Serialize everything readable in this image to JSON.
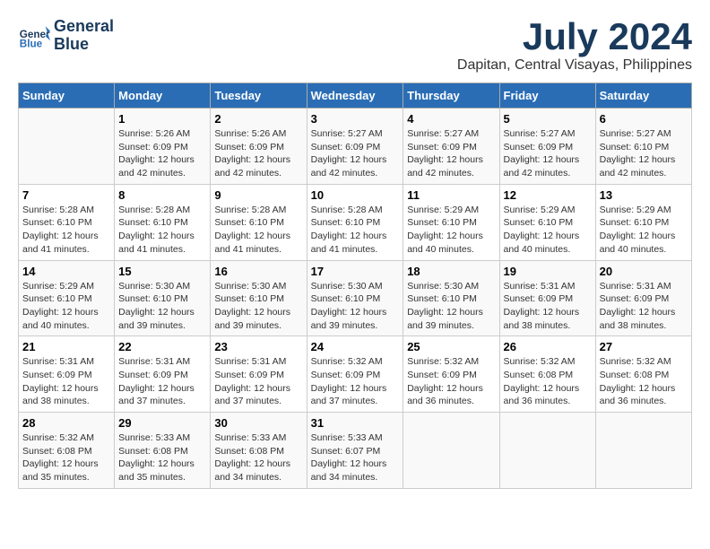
{
  "logo": {
    "line1": "General",
    "line2": "Blue"
  },
  "title": "July 2024",
  "subtitle": "Dapitan, Central Visayas, Philippines",
  "days_header": [
    "Sunday",
    "Monday",
    "Tuesday",
    "Wednesday",
    "Thursday",
    "Friday",
    "Saturday"
  ],
  "weeks": [
    [
      {
        "day": "",
        "info": ""
      },
      {
        "day": "1",
        "info": "Sunrise: 5:26 AM\nSunset: 6:09 PM\nDaylight: 12 hours\nand 42 minutes."
      },
      {
        "day": "2",
        "info": "Sunrise: 5:26 AM\nSunset: 6:09 PM\nDaylight: 12 hours\nand 42 minutes."
      },
      {
        "day": "3",
        "info": "Sunrise: 5:27 AM\nSunset: 6:09 PM\nDaylight: 12 hours\nand 42 minutes."
      },
      {
        "day": "4",
        "info": "Sunrise: 5:27 AM\nSunset: 6:09 PM\nDaylight: 12 hours\nand 42 minutes."
      },
      {
        "day": "5",
        "info": "Sunrise: 5:27 AM\nSunset: 6:09 PM\nDaylight: 12 hours\nand 42 minutes."
      },
      {
        "day": "6",
        "info": "Sunrise: 5:27 AM\nSunset: 6:10 PM\nDaylight: 12 hours\nand 42 minutes."
      }
    ],
    [
      {
        "day": "7",
        "info": "Sunrise: 5:28 AM\nSunset: 6:10 PM\nDaylight: 12 hours\nand 41 minutes."
      },
      {
        "day": "8",
        "info": "Sunrise: 5:28 AM\nSunset: 6:10 PM\nDaylight: 12 hours\nand 41 minutes."
      },
      {
        "day": "9",
        "info": "Sunrise: 5:28 AM\nSunset: 6:10 PM\nDaylight: 12 hours\nand 41 minutes."
      },
      {
        "day": "10",
        "info": "Sunrise: 5:28 AM\nSunset: 6:10 PM\nDaylight: 12 hours\nand 41 minutes."
      },
      {
        "day": "11",
        "info": "Sunrise: 5:29 AM\nSunset: 6:10 PM\nDaylight: 12 hours\nand 40 minutes."
      },
      {
        "day": "12",
        "info": "Sunrise: 5:29 AM\nSunset: 6:10 PM\nDaylight: 12 hours\nand 40 minutes."
      },
      {
        "day": "13",
        "info": "Sunrise: 5:29 AM\nSunset: 6:10 PM\nDaylight: 12 hours\nand 40 minutes."
      }
    ],
    [
      {
        "day": "14",
        "info": "Sunrise: 5:29 AM\nSunset: 6:10 PM\nDaylight: 12 hours\nand 40 minutes."
      },
      {
        "day": "15",
        "info": "Sunrise: 5:30 AM\nSunset: 6:10 PM\nDaylight: 12 hours\nand 39 minutes."
      },
      {
        "day": "16",
        "info": "Sunrise: 5:30 AM\nSunset: 6:10 PM\nDaylight: 12 hours\nand 39 minutes."
      },
      {
        "day": "17",
        "info": "Sunrise: 5:30 AM\nSunset: 6:10 PM\nDaylight: 12 hours\nand 39 minutes."
      },
      {
        "day": "18",
        "info": "Sunrise: 5:30 AM\nSunset: 6:10 PM\nDaylight: 12 hours\nand 39 minutes."
      },
      {
        "day": "19",
        "info": "Sunrise: 5:31 AM\nSunset: 6:09 PM\nDaylight: 12 hours\nand 38 minutes."
      },
      {
        "day": "20",
        "info": "Sunrise: 5:31 AM\nSunset: 6:09 PM\nDaylight: 12 hours\nand 38 minutes."
      }
    ],
    [
      {
        "day": "21",
        "info": "Sunrise: 5:31 AM\nSunset: 6:09 PM\nDaylight: 12 hours\nand 38 minutes."
      },
      {
        "day": "22",
        "info": "Sunrise: 5:31 AM\nSunset: 6:09 PM\nDaylight: 12 hours\nand 37 minutes."
      },
      {
        "day": "23",
        "info": "Sunrise: 5:31 AM\nSunset: 6:09 PM\nDaylight: 12 hours\nand 37 minutes."
      },
      {
        "day": "24",
        "info": "Sunrise: 5:32 AM\nSunset: 6:09 PM\nDaylight: 12 hours\nand 37 minutes."
      },
      {
        "day": "25",
        "info": "Sunrise: 5:32 AM\nSunset: 6:09 PM\nDaylight: 12 hours\nand 36 minutes."
      },
      {
        "day": "26",
        "info": "Sunrise: 5:32 AM\nSunset: 6:08 PM\nDaylight: 12 hours\nand 36 minutes."
      },
      {
        "day": "27",
        "info": "Sunrise: 5:32 AM\nSunset: 6:08 PM\nDaylight: 12 hours\nand 36 minutes."
      }
    ],
    [
      {
        "day": "28",
        "info": "Sunrise: 5:32 AM\nSunset: 6:08 PM\nDaylight: 12 hours\nand 35 minutes."
      },
      {
        "day": "29",
        "info": "Sunrise: 5:33 AM\nSunset: 6:08 PM\nDaylight: 12 hours\nand 35 minutes."
      },
      {
        "day": "30",
        "info": "Sunrise: 5:33 AM\nSunset: 6:08 PM\nDaylight: 12 hours\nand 34 minutes."
      },
      {
        "day": "31",
        "info": "Sunrise: 5:33 AM\nSunset: 6:07 PM\nDaylight: 12 hours\nand 34 minutes."
      },
      {
        "day": "",
        "info": ""
      },
      {
        "day": "",
        "info": ""
      },
      {
        "day": "",
        "info": ""
      }
    ]
  ]
}
